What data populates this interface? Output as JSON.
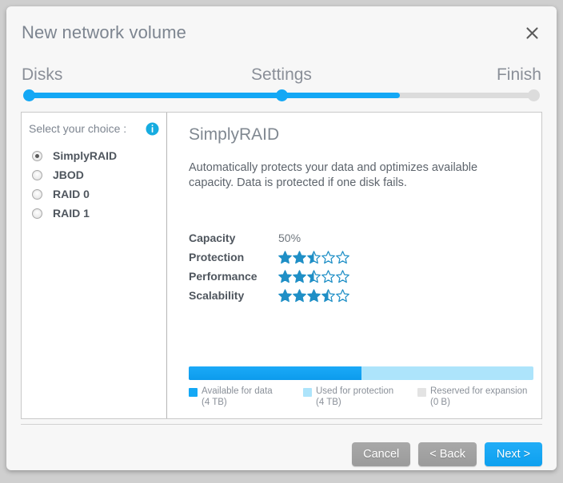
{
  "dialog": {
    "title": "New network volume",
    "close_label": "✕"
  },
  "stepper": {
    "steps": [
      {
        "label": "Disks",
        "state": "done"
      },
      {
        "label": "Settings",
        "state": "current"
      },
      {
        "label": "Finish",
        "state": "upcoming"
      }
    ],
    "progress_percent": 73,
    "active_color": "#14a8f5",
    "inactive_color": "#dcdcdc"
  },
  "choice_panel": {
    "heading": "Select your choice :",
    "info_icon": "info-icon",
    "selected": "SimplyRAID",
    "options": [
      {
        "label": "SimplyRAID",
        "selected": true
      },
      {
        "label": "JBOD",
        "selected": false
      },
      {
        "label": "RAID 0",
        "selected": false
      },
      {
        "label": "RAID 1",
        "selected": false
      }
    ]
  },
  "detail": {
    "title": "SimplyRAID",
    "description": "Automatically protects your data and optimizes available capacity. Data is protected if one disk fails.",
    "metrics": [
      {
        "name": "Capacity",
        "type": "text",
        "value": "50%"
      },
      {
        "name": "Protection",
        "type": "stars",
        "value": 2.5,
        "max": 5
      },
      {
        "name": "Performance",
        "type": "stars",
        "value": 2.5,
        "max": 5
      },
      {
        "name": "Scalability",
        "type": "stars",
        "value": 3.5,
        "max": 5
      }
    ],
    "star_color": "#1f8fc6"
  },
  "capacity": {
    "available_percent": 50,
    "segments": [
      {
        "label": "Available for data",
        "sublabel": "(4 TB)",
        "color": "#14a8f5",
        "percent": 50
      },
      {
        "label": "Used for protection",
        "sublabel": "(4 TB)",
        "color": "#ade4fb",
        "percent": 50
      },
      {
        "label": "Reserved for expansion",
        "sublabel": "(0 B)",
        "color": "#e3e3e3",
        "percent": 0
      }
    ]
  },
  "footer": {
    "cancel_label": "Cancel",
    "back_label": "< Back",
    "next_label": "Next >"
  }
}
